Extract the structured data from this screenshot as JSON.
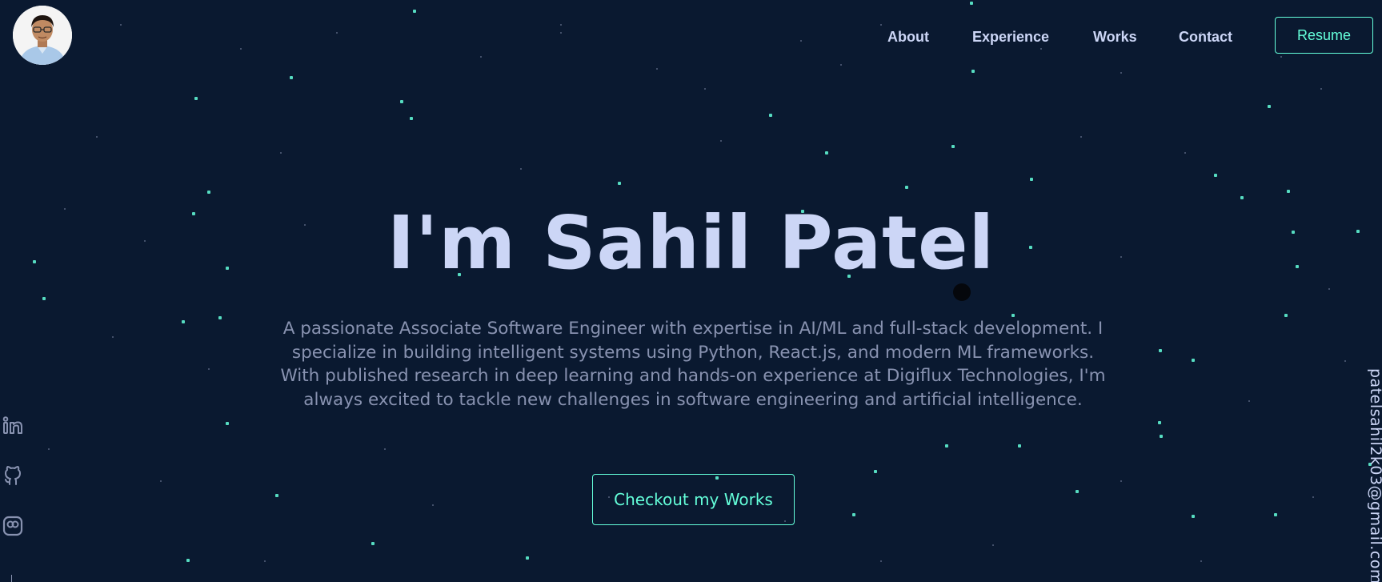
{
  "header": {
    "avatar_alt": "Sahil Patel profile photo",
    "nav": [
      {
        "label": "About"
      },
      {
        "label": "Experience"
      },
      {
        "label": "Works"
      },
      {
        "label": "Contact"
      }
    ],
    "resume_label": "Resume"
  },
  "hero": {
    "title": "I'm Sahil Patel",
    "description": "A passionate Associate Software Engineer with expertise in AI/ML and full-stack development. I specialize in building intelligent systems using Python, React.js, and modern ML frameworks. With published research in deep learning and hands-on experience at Digiflux Technologies, I'm always excited to tackle new challenges in software engineering and artificial intelligence.",
    "cta_label": "Checkout my Works"
  },
  "socials": [
    {
      "icon": "linkedin-icon"
    },
    {
      "icon": "github-icon"
    },
    {
      "icon": "instagram-icon"
    }
  ],
  "email": "patelsahil2k03@gmail.com",
  "colors": {
    "background": "#0a1930",
    "accent": "#64ffda",
    "heading": "#ccd6f6",
    "body_text": "#8892b0"
  }
}
